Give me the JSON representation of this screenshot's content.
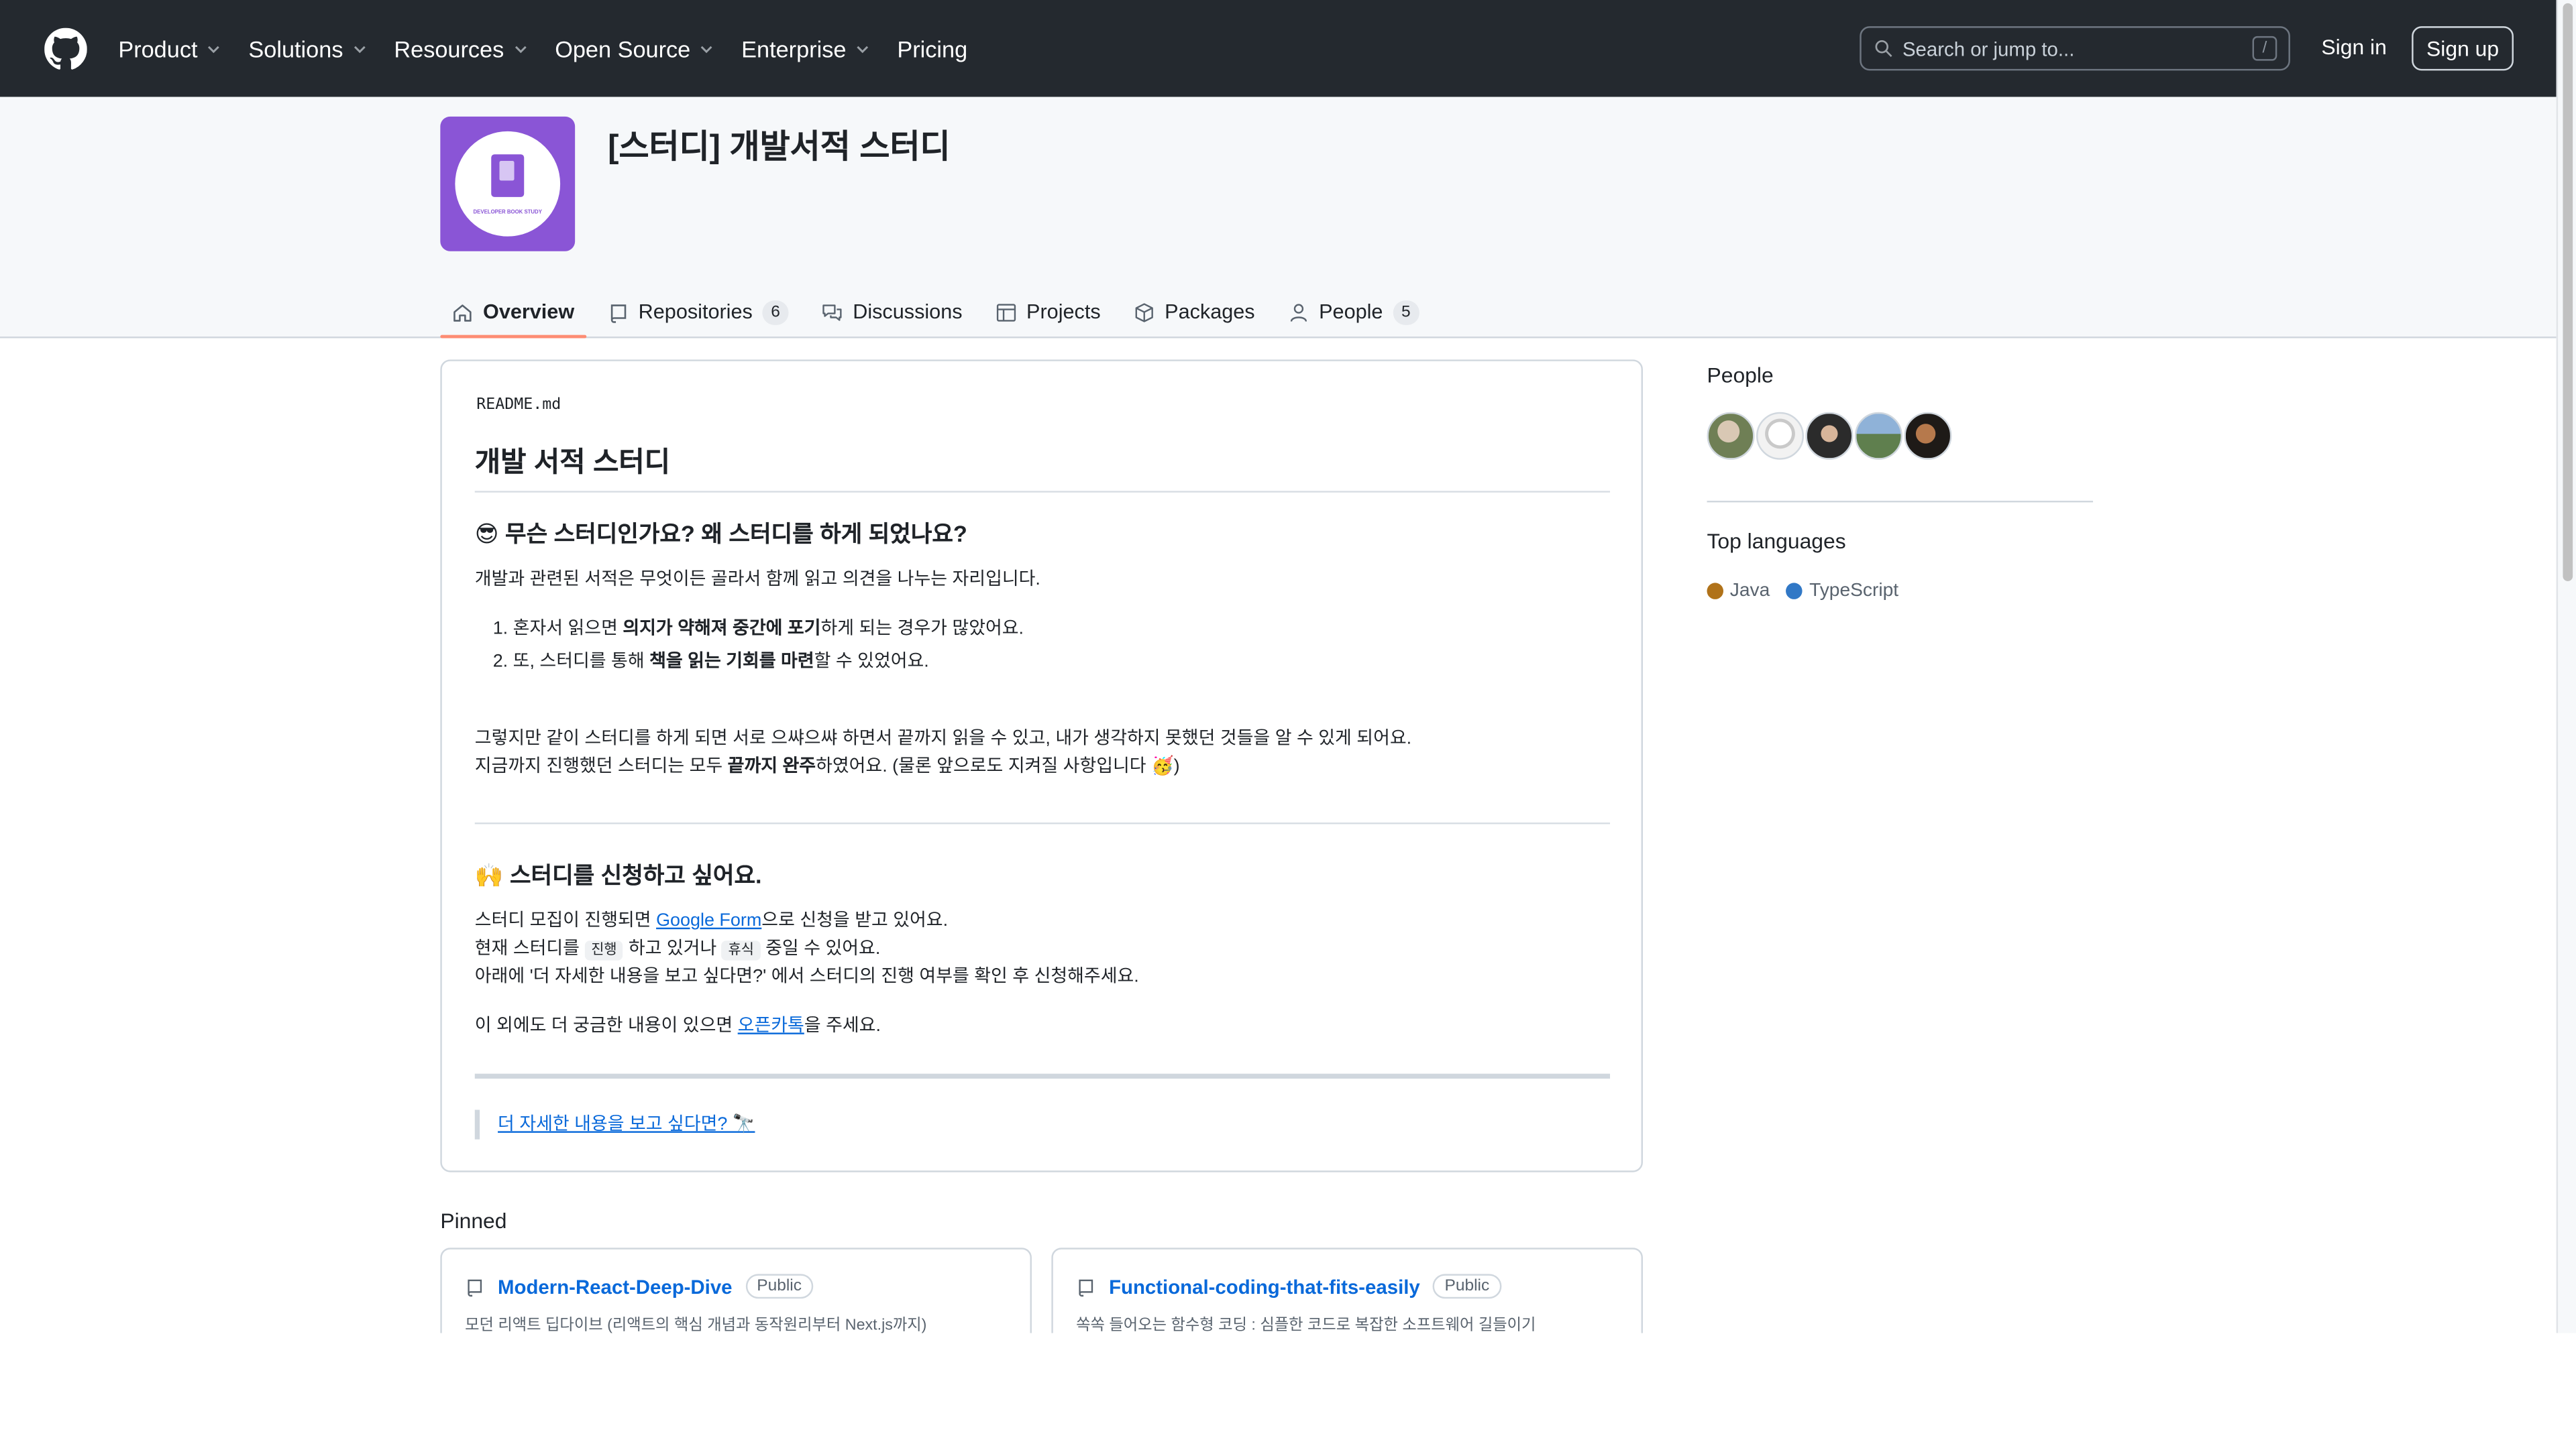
{
  "header": {
    "nav": [
      {
        "label": "Product",
        "dropdown": true
      },
      {
        "label": "Solutions",
        "dropdown": true
      },
      {
        "label": "Resources",
        "dropdown": true
      },
      {
        "label": "Open Source",
        "dropdown": true
      },
      {
        "label": "Enterprise",
        "dropdown": true
      },
      {
        "label": "Pricing",
        "dropdown": false
      }
    ],
    "search_placeholder": "Search or jump to...",
    "search_key": "/",
    "sign_in": "Sign in",
    "sign_up": "Sign up"
  },
  "org": {
    "name": "[스터디] 개발서적 스터디",
    "avatar_text": "DEVELOPER BOOK STUDY",
    "tabs": [
      {
        "label": "Overview",
        "icon": "home-icon",
        "count": null,
        "selected": true
      },
      {
        "label": "Repositories",
        "icon": "repo-icon",
        "count": "6",
        "selected": false
      },
      {
        "label": "Discussions",
        "icon": "comment-discussion-icon",
        "count": null,
        "selected": false
      },
      {
        "label": "Projects",
        "icon": "table-icon",
        "count": null,
        "selected": false
      },
      {
        "label": "Packages",
        "icon": "package-icon",
        "count": null,
        "selected": false
      },
      {
        "label": "People",
        "icon": "person-icon",
        "count": "5",
        "selected": false
      }
    ]
  },
  "readme": {
    "filename": "README.md",
    "title": "개발 서적 스터디",
    "section1_title": "😎 무슨 스터디인가요? 왜 스터디를 하게 되었나요?",
    "intro": "개발과 관련된 서적은 무엇이든 골라서 함께 읽고 의견을 나누는 자리입니다.",
    "list1_prefix": "혼자서 읽으면 ",
    "list1_bold": "의지가 약해져 중간에 포기",
    "list1_suffix": "하게 되는 경우가 많았어요.",
    "list2_prefix": "또, 스터디를 통해 ",
    "list2_bold": "책을 읽는 기회를 마련",
    "list2_suffix": "할 수 있었어요.",
    "para1": "그렇지만 같이 스터디를 하게 되면 서로 으쌰으쌰 하면서 끝까지 읽을 수 있고, 내가 생각하지 못했던 것들을 알 수 있게 되어요.",
    "para2_prefix": "지금까지 진행했던 스터디는 모두 ",
    "para2_bold": "끝까지 완주",
    "para2_suffix": "하였어요. (물론 앞으로도 지켜질 사항입니다 🥳)",
    "section2_title": "🙌 스터디를 신청하고 싶어요.",
    "apply1_prefix": "스터디 모집이 진행되면 ",
    "apply1_link": "Google Form",
    "apply1_suffix": "으로 신청을 받고 있어요.",
    "apply2_prefix": "현재 스터디를 ",
    "apply2_code1": "진행",
    "apply2_mid": " 하고 있거나 ",
    "apply2_code2": "휴식",
    "apply2_suffix": " 중일 수 있어요.",
    "apply3": "아래에 '더 자세한 내용을 보고 싶다면?' 에서 스터디의 진행 여부를 확인 후 신청해주세요.",
    "contact_prefix": "이 외에도 더 궁금한 내용이 있으면 ",
    "contact_link": "오픈카톡",
    "contact_suffix": "을 주세요.",
    "more_link": "더 자세한 내용을 보고 싶다면? 🔭"
  },
  "pinned": {
    "label": "Pinned",
    "items": [
      {
        "name": "Modern-React-Deep-Dive",
        "visibility": "Public",
        "description": "모던 리액트 딥다이브 (리액트의 핵심 개념과 동작원리부터 Next.js까지)"
      },
      {
        "name": "Functional-coding-that-fits-easily",
        "visibility": "Public",
        "description": "쏙쏙 들어오는 함수형 코딩 : 심플한 코드로 복잡한 소프트웨어 길들이기"
      }
    ]
  },
  "sidebar": {
    "people_title": "People",
    "people_count": 5,
    "languages_title": "Top languages",
    "languages": [
      {
        "name": "Java",
        "color": "#b07219"
      },
      {
        "name": "TypeScript",
        "color": "#3178c6"
      }
    ]
  }
}
